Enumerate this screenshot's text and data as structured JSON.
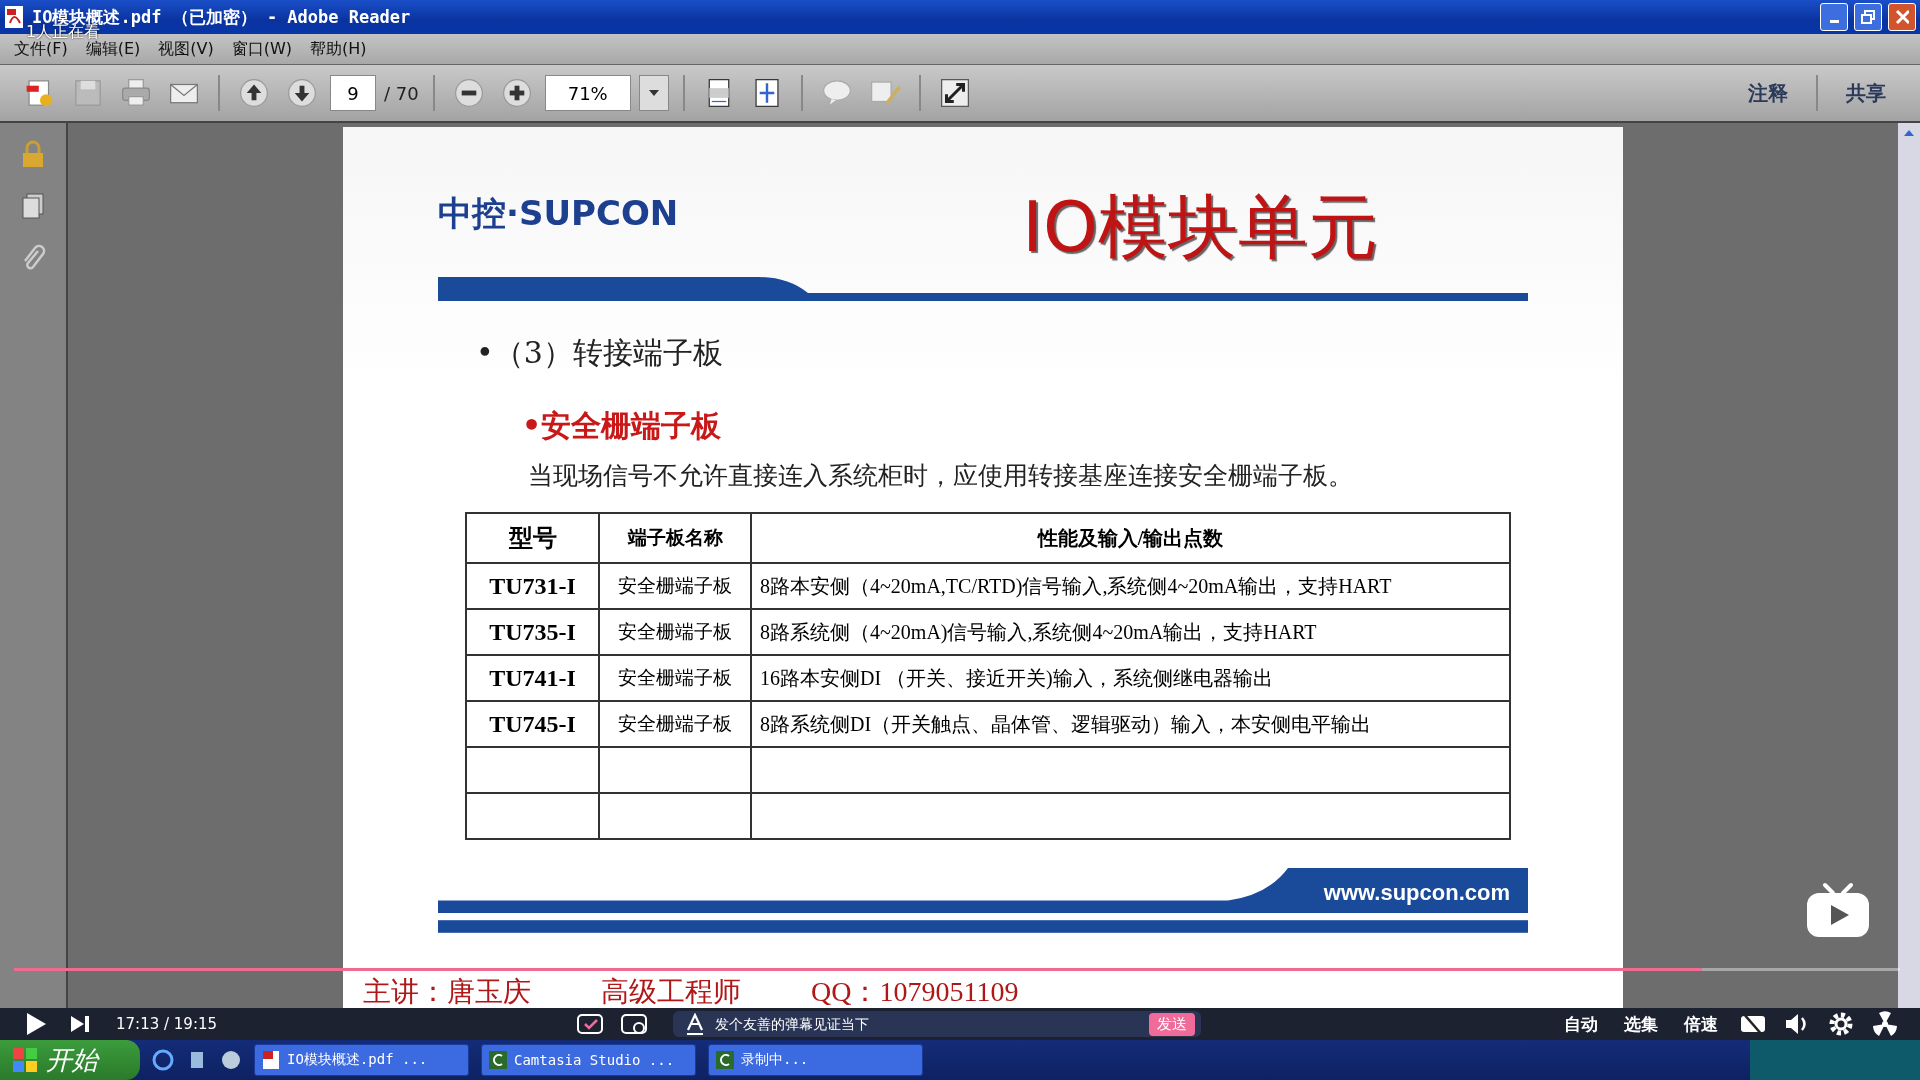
{
  "window": {
    "title": "IO模块概述.pdf （已加密） - Adobe Reader"
  },
  "viewers": "1人正在看",
  "menu": [
    "文件(F)",
    "编辑(E)",
    "视图(V)",
    "窗口(W)",
    "帮助(H)"
  ],
  "toolbar": {
    "page": "9",
    "page_total": "/ 70",
    "zoom": "71%",
    "right_buttons": [
      "注释",
      "共享"
    ]
  },
  "slide": {
    "logo": "中控·SUPCON",
    "title": "IO模块单元",
    "heading": "•（3）转接端子板",
    "subheading": "•安全栅端子板",
    "paragraph": "当现场信号不允许直接连入系统柜时，应使用转接基座连接安全栅端子板。",
    "table": {
      "columns": [
        "型号",
        "端子板名称",
        "性能及输入/输出点数"
      ],
      "rows": [
        [
          "TU731-I",
          "安全栅端子板",
          "8路本安侧（4~20mA,TC/RTD)信号输入,系统侧4~20mA输出，支持HART"
        ],
        [
          "TU735-I",
          "安全栅端子板",
          "8路系统侧（4~20mA)信号输入,系统侧4~20mA输出，支持HART"
        ],
        [
          "TU741-I",
          "安全栅端子板",
          "16路本安侧DI （开关、接近开关)输入，系统侧继电器输出"
        ],
        [
          "TU745-I",
          "安全栅端子板",
          "8路系统侧DI（开关触点、晶体管、逻辑驱动）输入，本安侧电平输出"
        ]
      ]
    },
    "website": "www.supcon.com",
    "footer": [
      "主讲：唐玉庆",
      "高级工程师",
      "QQ：1079051109"
    ]
  },
  "player": {
    "progress": {
      "level": 0.895
    },
    "time": "17:13 / 19:15",
    "danmaku_placeholder": "发个友善的弹幕见证当下",
    "send": "发送",
    "buttons": [
      "自动",
      "选集",
      "倍速"
    ]
  },
  "taskbar": {
    "start": "开始",
    "tasks": [
      {
        "label": "IO模块概述.pdf ...",
        "kind": "pdf"
      },
      {
        "label": "Camtasia Studio ...",
        "kind": "camtasia"
      },
      {
        "label": "录制中...",
        "kind": "camtasia"
      }
    ]
  }
}
